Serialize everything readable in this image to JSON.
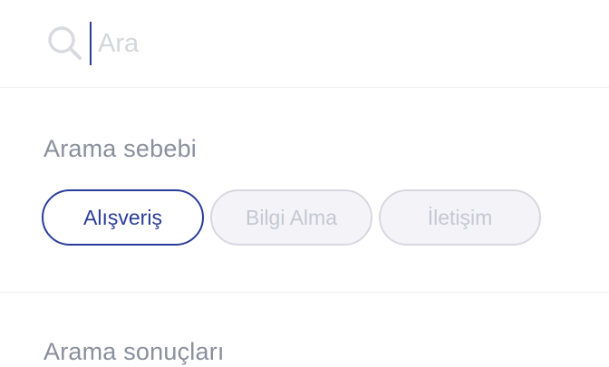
{
  "search": {
    "placeholder": "Ara",
    "value": ""
  },
  "reason_section": {
    "title": "Arama sebebi",
    "options": [
      {
        "label": "Alışveriş",
        "selected": true
      },
      {
        "label": "Bilgi Alma",
        "selected": false
      },
      {
        "label": "İletişim",
        "selected": false
      }
    ]
  },
  "results_section": {
    "title": "Arama sonuçları"
  },
  "colors": {
    "accent": "#2a3d9a",
    "muted_text": "#8a8f9c",
    "chip_inactive_bg": "#f4f4f8",
    "chip_inactive_border": "#d7d8df",
    "placeholder": "#d5d6dc"
  }
}
